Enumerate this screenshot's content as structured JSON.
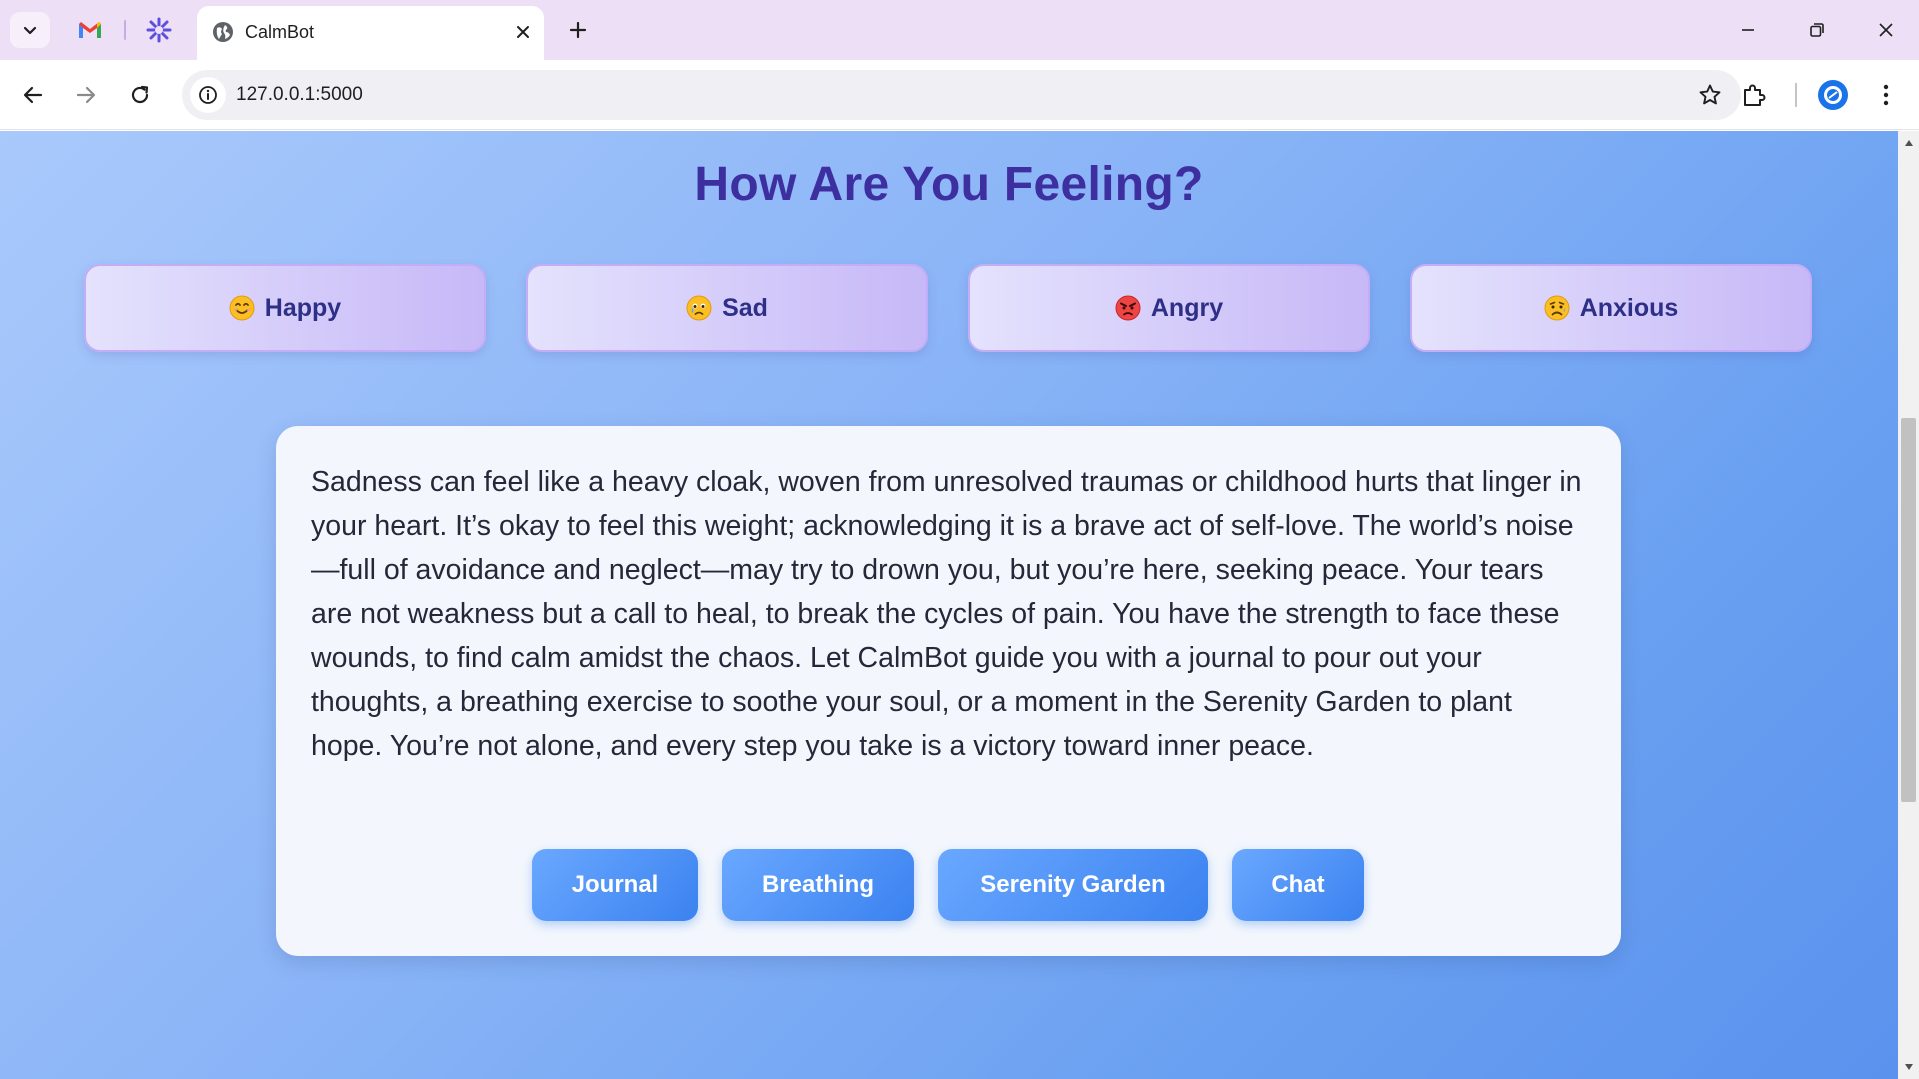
{
  "browser": {
    "tab_title": "CalmBot",
    "url": "127.0.0.1:5000",
    "icons": {
      "tab_search": "chevron-down-icon",
      "pinned_1": "gmail-icon",
      "pinned_2": "asterisk-app-icon",
      "favicon": "globe-icon",
      "tab_close": "close-icon",
      "new_tab": "plus-icon",
      "back": "arrow-left-icon",
      "forward": "arrow-right-icon",
      "reload": "reload-icon",
      "site_info": "info-icon",
      "bookmark": "star-icon",
      "extensions": "puzzle-icon",
      "profile": "avatar",
      "menu": "kebab-menu-icon",
      "minimize": "minimize-icon",
      "restore": "restore-icon",
      "close_window": "close-icon"
    }
  },
  "page": {
    "heading": "How Are You Feeling?",
    "moods": [
      {
        "label": "Happy",
        "emoji": "smile-emoji"
      },
      {
        "label": "Sad",
        "emoji": "sad-emoji"
      },
      {
        "label": "Angry",
        "emoji": "angry-emoji"
      },
      {
        "label": "Anxious",
        "emoji": "anxious-emoji"
      }
    ],
    "message": "Sadness can feel like a heavy cloak, woven from unresolved traumas or childhood hurts that linger in your heart. It’s okay to feel this weight; acknowledging it is a brave act of self-love. The world’s noise—full of avoidance and neglect—may try to drown you, but you’re here, seeking peace. Your tears are not weakness but a call to heal, to break the cycles of pain. You have the strength to face these wounds, to find calm amidst the chaos. Let CalmBot guide you with a journal to pour out your thoughts, a breathing exercise to soothe your soul, or a moment in the Serenity Garden to plant hope. You’re not alone, and every step you take is a victory toward inner peace.",
    "actions": [
      "Journal",
      "Breathing",
      "Serenity Garden",
      "Chat"
    ]
  },
  "colors": {
    "heading": "#3d2fa0",
    "mood_label": "#2e2f86",
    "action_button": "#3b82f0",
    "background_gradient_start": "#a9c9fb",
    "background_gradient_end": "#5a92ee"
  }
}
